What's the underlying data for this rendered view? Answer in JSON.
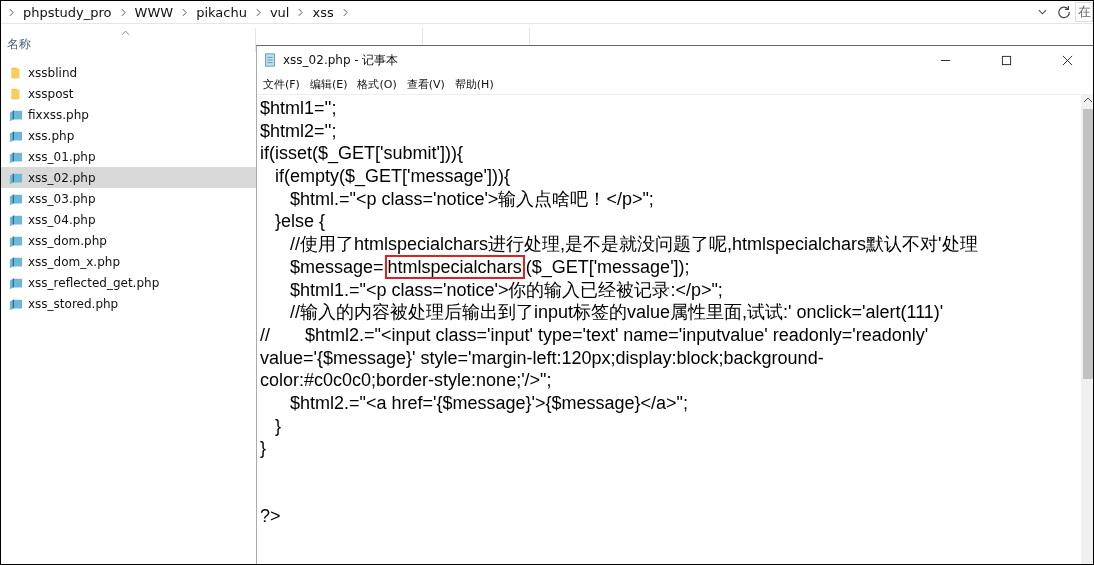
{
  "address_bar": {
    "path": [
      "phpstudy_pro",
      "WWW",
      "pikachu",
      "vul",
      "xss"
    ],
    "search_placeholder": "在"
  },
  "columns": [
    {
      "label": "名称"
    }
  ],
  "files": [
    {
      "name": "xssblind",
      "kind": "folder",
      "selected": false
    },
    {
      "name": "xsspost",
      "kind": "folder",
      "selected": false
    },
    {
      "name": "fixxss.php",
      "kind": "file",
      "selected": false
    },
    {
      "name": "xss.php",
      "kind": "file",
      "selected": false
    },
    {
      "name": "xss_01.php",
      "kind": "file",
      "selected": false
    },
    {
      "name": "xss_02.php",
      "kind": "file",
      "selected": true
    },
    {
      "name": "xss_03.php",
      "kind": "file",
      "selected": false
    },
    {
      "name": "xss_04.php",
      "kind": "file",
      "selected": false
    },
    {
      "name": "xss_dom.php",
      "kind": "file",
      "selected": false
    },
    {
      "name": "xss_dom_x.php",
      "kind": "file",
      "selected": false
    },
    {
      "name": "xss_reflected_get.php",
      "kind": "file",
      "selected": false
    },
    {
      "name": "xss_stored.php",
      "kind": "file",
      "selected": false
    }
  ],
  "notepad": {
    "title": "xss_02.php - 记事本",
    "menu": [
      "文件(F)",
      "编辑(E)",
      "格式(O)",
      "查看(V)",
      "帮助(H)"
    ],
    "lines": [
      {
        "text": "$html1='';"
      },
      {
        "text": "$html2='';"
      },
      {
        "text": "if(isset($_GET['submit'])){"
      },
      {
        "text": "   if(empty($_GET['message'])){"
      },
      {
        "text": "      $html.=\"<p class='notice'>输入点啥吧！</p>\";"
      },
      {
        "text": "   }else {"
      },
      {
        "text": "      //使用了htmlspecialchars进行处理,是不是就没问题了呢,htmlspecialchars默认不对'处理"
      },
      {
        "text": "      $message=",
        "boxed": "htmlspecialchars",
        "rest": "($_GET['message']);"
      },
      {
        "text": "      $html1.=\"<p class='notice'>你的输入已经被记录:</p>\";"
      },
      {
        "text": "      //输入的内容被处理后输出到了input标签的value属性里面,试试:' onclick='alert(111)'"
      },
      {
        "text": "//       $html2.=\"<input class='input' type='text' name='inputvalue' readonly='readonly'"
      },
      {
        "text": "value='{$message}' style='margin-left:120px;display:block;background-"
      },
      {
        "text": "color:#c0c0c0;border-style:none;'/>\";"
      },
      {
        "text": "      $html2.=\"<a href='{$message}'>{$message}</a>\";"
      },
      {
        "text": "   }"
      },
      {
        "text": "}"
      },
      {
        "text": "?>"
      }
    ]
  }
}
